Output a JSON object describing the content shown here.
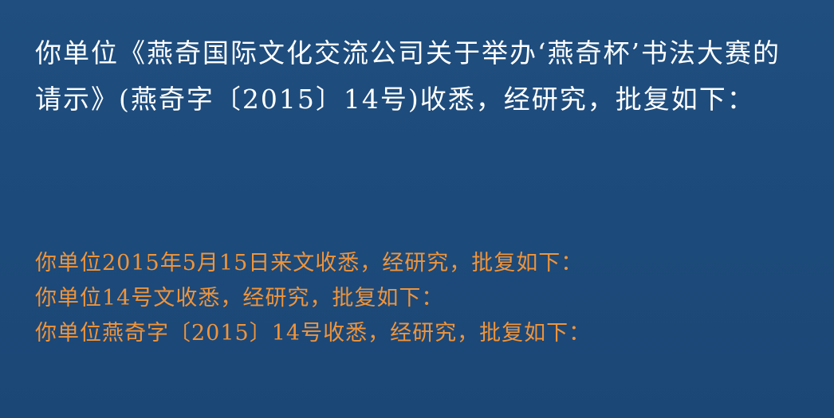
{
  "main_text": "你单位《燕奇国际文化交流公司关于举办‘燕奇杯’书法大赛的请示》(燕奇字〔2015〕14号)收悉，经研究，批复如下：",
  "examples": [
    "你单位2015年5月15日来文收悉，经研究，批复如下：",
    "你单位14号文收悉，经研究，批复如下：",
    "你单位燕奇字〔2015〕14号收悉，经研究，批复如下："
  ],
  "colors": {
    "background": "#1f4c7c",
    "main_text": "#ffffff",
    "example_text": "#f0943a"
  }
}
